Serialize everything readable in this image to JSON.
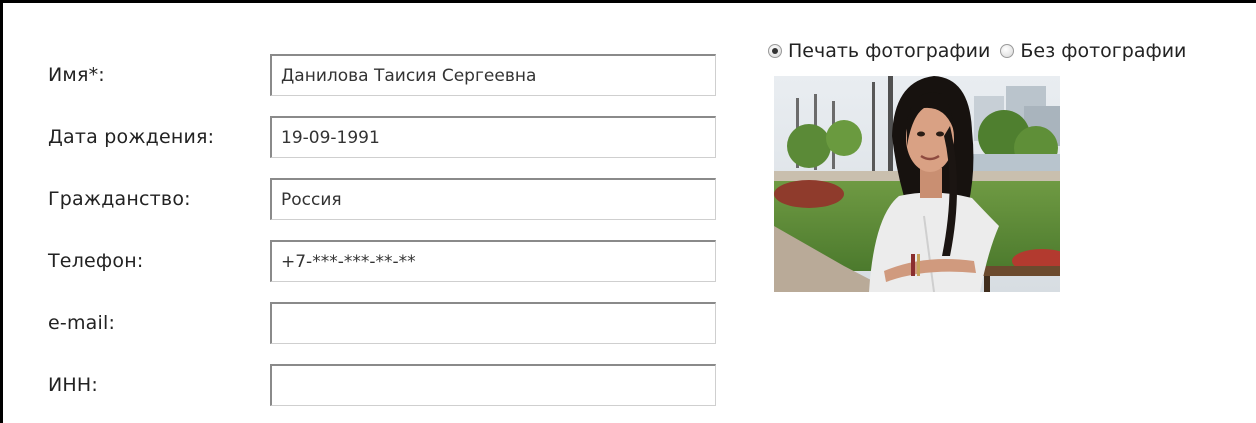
{
  "form": {
    "fields": [
      {
        "label": "Имя*:",
        "value": "Данилова Таисия Сергеевна"
      },
      {
        "label": "Дата рождения:",
        "value": "19-09-1991"
      },
      {
        "label": "Гражданство:",
        "value": "Россия"
      },
      {
        "label": "Телефон:",
        "value": "+7-***-***-**-**"
      },
      {
        "label": "e-mail:",
        "value": ""
      },
      {
        "label": "ИНН:",
        "value": ""
      }
    ]
  },
  "photo_options": {
    "print_label": "Печать фотографии",
    "no_photo_label": "Без фотографии",
    "selected": "print"
  },
  "photo": {
    "description_icon": "portrait-photo"
  }
}
